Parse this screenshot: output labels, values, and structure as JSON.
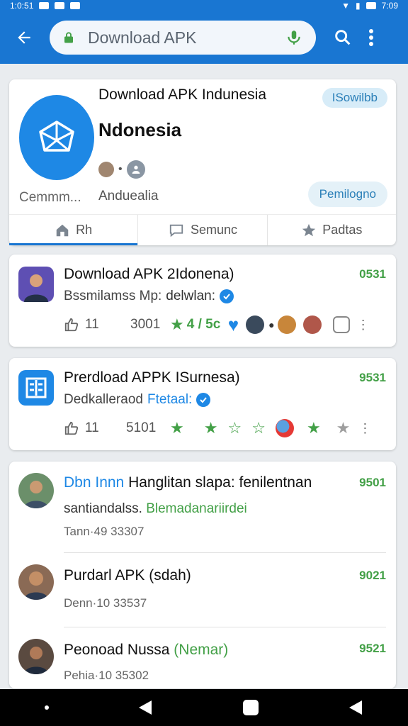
{
  "status_bar": {
    "time_left": "1:0:51",
    "time_right": "7:09"
  },
  "browser": {
    "url": "Download APK",
    "back_icon": "arrow-left-icon",
    "search_icon": "search-icon",
    "more_icon": "more-vert-icon"
  },
  "header": {
    "title": "Download APK Indunesia",
    "subtitle": "Ndonesia",
    "pill_top": "ISowilbb",
    "label_left": "Cemmm...",
    "label_mid": "Anduealia",
    "pill_right": "Pemilogno",
    "tabs": [
      {
        "label": "Rh",
        "icon": "home-icon",
        "active": true
      },
      {
        "label": "Semunc",
        "icon": "comment-icon",
        "active": false
      },
      {
        "label": "Padtas",
        "icon": "star-icon",
        "active": false
      }
    ]
  },
  "apps": [
    {
      "title": "Download APK 2Idonena)",
      "sub": "Bssmilamss Mp:",
      "sub_accent": "delwlan:",
      "badge": "0531",
      "likes": "11",
      "count": "3001",
      "rating": "4 / 5c"
    },
    {
      "title": "Prerdload APPK ISurnesa)",
      "sub": "Dedkalleraod",
      "sub_accent": "Ftetaal:",
      "badge": "9531",
      "likes": "11",
      "count": "5101"
    }
  ],
  "list": [
    {
      "title_blue": "Dbn Innn",
      "title_rest": " Hanglitan slapa: fenilentnan",
      "sub": "santiandalss.",
      "sub_green": "Blemadanariirdei",
      "meta": "Tann·49 33307",
      "badge": "9501"
    },
    {
      "title": "Purdarl APK (sdah)",
      "meta": "Denn·10 33537",
      "badge": "9021"
    },
    {
      "title": "Peonoad Nussa ",
      "title_green": "(Nemar)",
      "meta": "Pehia·10 35302",
      "badge": "9521"
    }
  ],
  "colors": {
    "primary": "#1976d2",
    "accent_green": "#43a047",
    "accent_blue": "#1e88e5"
  }
}
